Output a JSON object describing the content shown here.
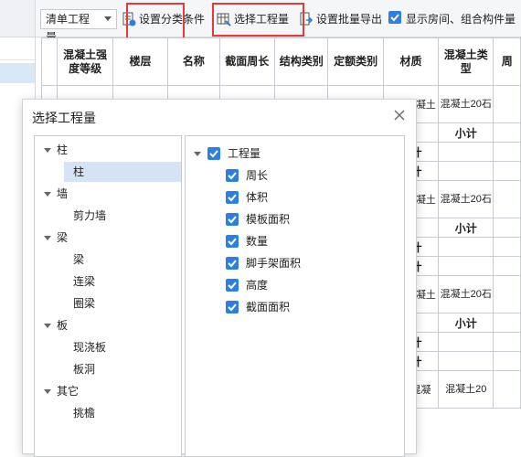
{
  "toolbar": {
    "dropdown_value": "清单工程量",
    "btn_classify": "设置分类条件",
    "btn_select_qty": "选择工程量",
    "btn_batch_export": "设置批量导出",
    "show_room_label": "显示房间、组合构件量",
    "show_room_checked": true
  },
  "grid": {
    "headers": [
      "混凝土强度等级",
      "楼层",
      "名称",
      "截面周长",
      "结构类别",
      "定额类别",
      "材质",
      "混凝土类型",
      "周"
    ],
    "rows": [
      {
        "material": "商品混凝土",
        "concrete_type": "混凝土20石"
      },
      {
        "sub": "小计"
      },
      {
        "sub2": "小计"
      },
      {
        "sub3": "小计"
      },
      {
        "material": "商品混凝土",
        "concrete_type": "混凝土20石"
      },
      {
        "sub": "小计"
      },
      {
        "sub2": "小计"
      },
      {
        "sub3": "小计"
      },
      {
        "material": "商品混凝土",
        "concrete_type": "混凝土20石"
      },
      {
        "sub": "小计"
      },
      {
        "sub2": "小计"
      },
      {
        "sub3": "小计"
      },
      {
        "material": "商品混凝",
        "concrete_type": "混凝土20"
      }
    ]
  },
  "dialog": {
    "title": "选择工程量",
    "component_tree": [
      {
        "label": "柱",
        "children": [
          "柱"
        ]
      },
      {
        "label": "墙",
        "children": [
          "剪力墙"
        ]
      },
      {
        "label": "梁",
        "children": [
          "梁",
          "连梁",
          "圈梁"
        ]
      },
      {
        "label": "板",
        "children": [
          "现浇板",
          "板洞"
        ]
      },
      {
        "label": "其它",
        "children": [
          "挑檐"
        ]
      }
    ],
    "selected_component": "柱",
    "quantity_root": "工程量",
    "quantities": [
      "周长",
      "体积",
      "模板面积",
      "数量",
      "脚手架面积",
      "高度",
      "截面面积"
    ]
  },
  "colors": {
    "accent": "#2f7fe0",
    "highlight_box": "#e23b3b",
    "selection": "#d4e4f5"
  }
}
